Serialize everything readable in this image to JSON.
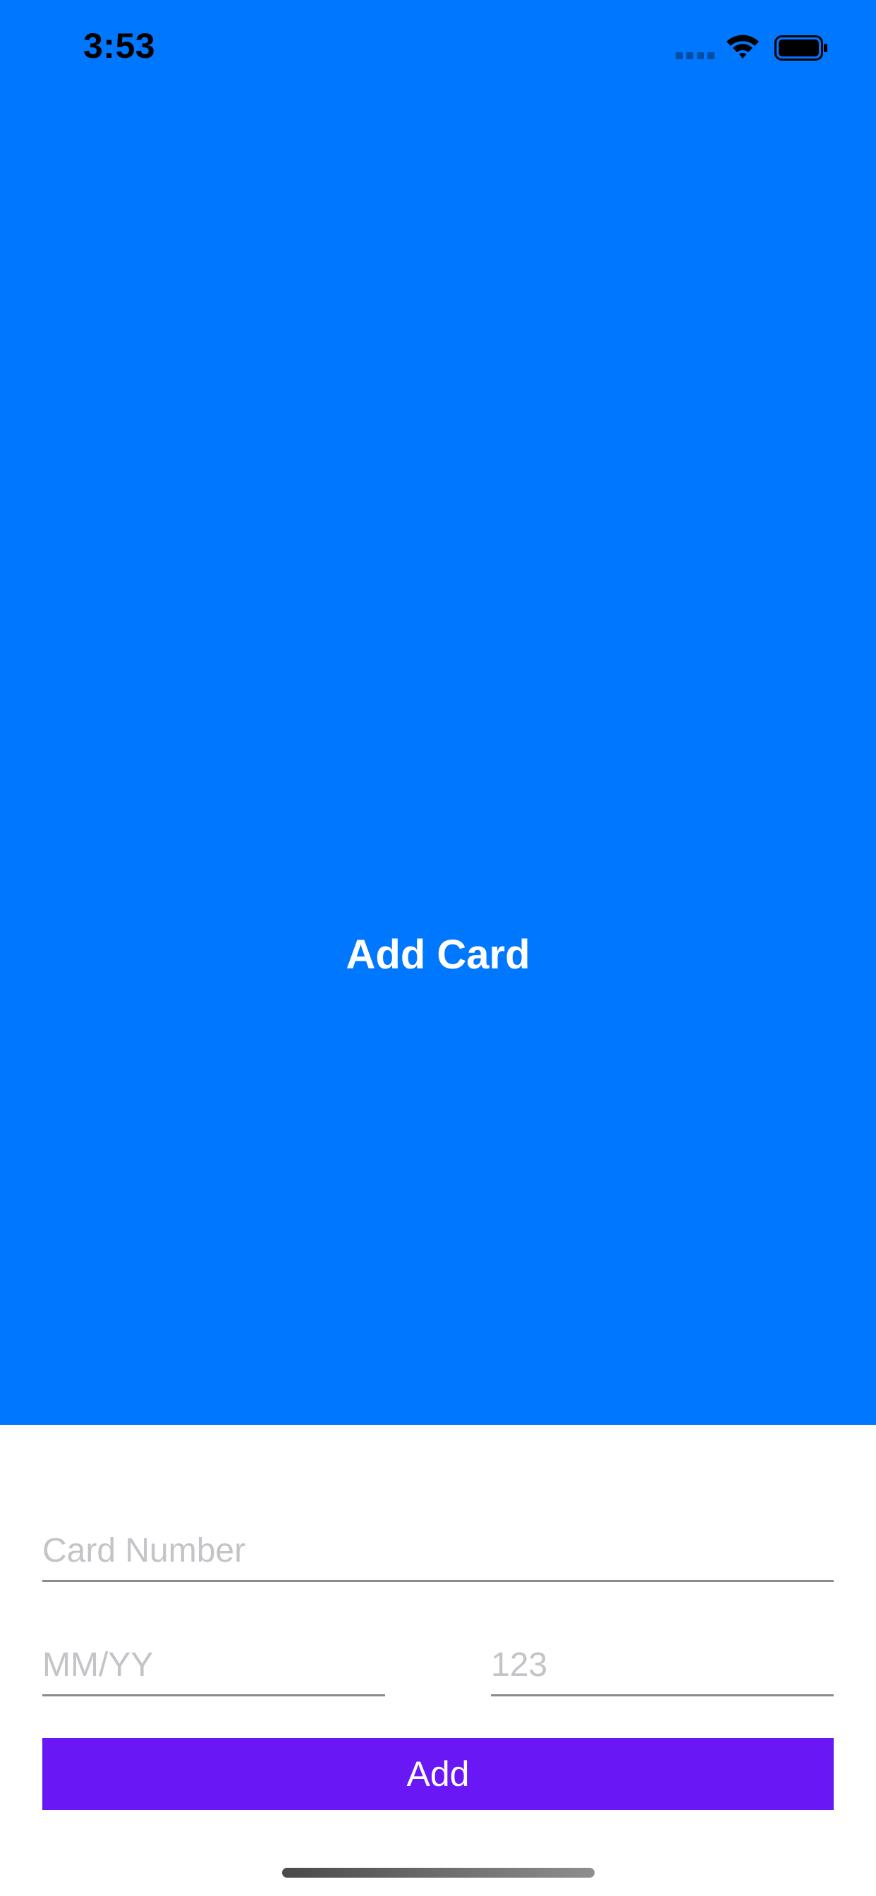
{
  "status_bar": {
    "time": "3:53",
    "icons": [
      "signal-icon",
      "wifi-icon",
      "battery-icon"
    ]
  },
  "hero": {
    "title": "Add Card",
    "background_color": "#0077FF"
  },
  "form": {
    "card_number": {
      "value": "",
      "placeholder": "Card Number"
    },
    "expiry": {
      "value": "",
      "placeholder": "MM/YY"
    },
    "cvc": {
      "value": "",
      "placeholder": "123"
    },
    "add_label": "Add",
    "add_button_color": "#6A17F5"
  }
}
